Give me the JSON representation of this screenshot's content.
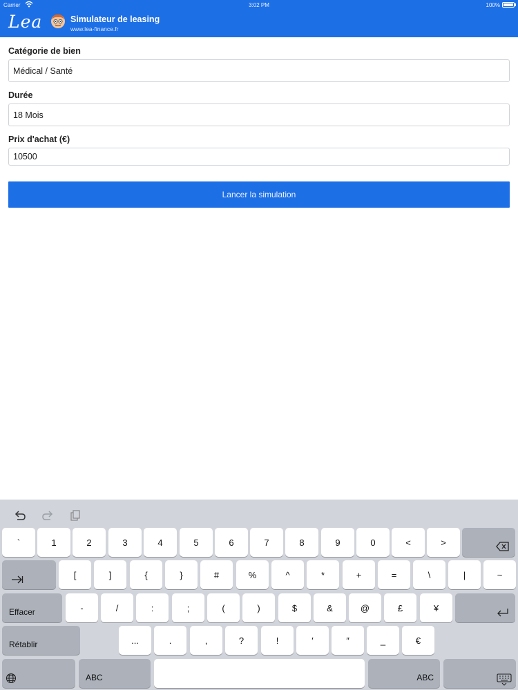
{
  "status_bar": {
    "carrier": "Carrier",
    "time": "3:02 PM",
    "battery": "100%"
  },
  "header": {
    "logo": "Lea",
    "title": "Simulateur de leasing",
    "url": "www.lea-finance.fr"
  },
  "form": {
    "category": {
      "label": "Catégorie de bien",
      "value": "Médical / Santé"
    },
    "duration": {
      "label": "Durée",
      "value": "18 Mois"
    },
    "price": {
      "label": "Prix d'achat (€)",
      "value": "10500"
    },
    "submit_label": "Lancer la simulation"
  },
  "keyboard": {
    "shortcuts": [
      "undo-icon",
      "redo-icon",
      "paste-icon"
    ],
    "row1": [
      "`",
      "1",
      "2",
      "3",
      "4",
      "5",
      "6",
      "7",
      "8",
      "9",
      "0",
      "<",
      ">"
    ],
    "row2": [
      "[",
      "]",
      "{",
      "}",
      "#",
      "%",
      "^",
      "*",
      "+",
      "=",
      "\\",
      "|",
      "~"
    ],
    "row3": [
      "-",
      "/",
      ":",
      ";",
      "(",
      ")",
      "$",
      "&",
      "@",
      "£",
      "¥"
    ],
    "row4": [
      "...",
      ".",
      ",",
      "?",
      "!",
      "′",
      "″",
      "_",
      "€"
    ],
    "clear_label": "Effacer",
    "restore_label": "Rétablir",
    "abc_label": "ABC",
    "icons": [
      "backspace-icon",
      "tab-icon",
      "return-icon",
      "globe-icon",
      "keyboard-dismiss-icon"
    ]
  },
  "colors": {
    "accent": "#1d6fe6",
    "keyboard_bg": "#d1d4db",
    "key_dark": "#acb1ba"
  }
}
